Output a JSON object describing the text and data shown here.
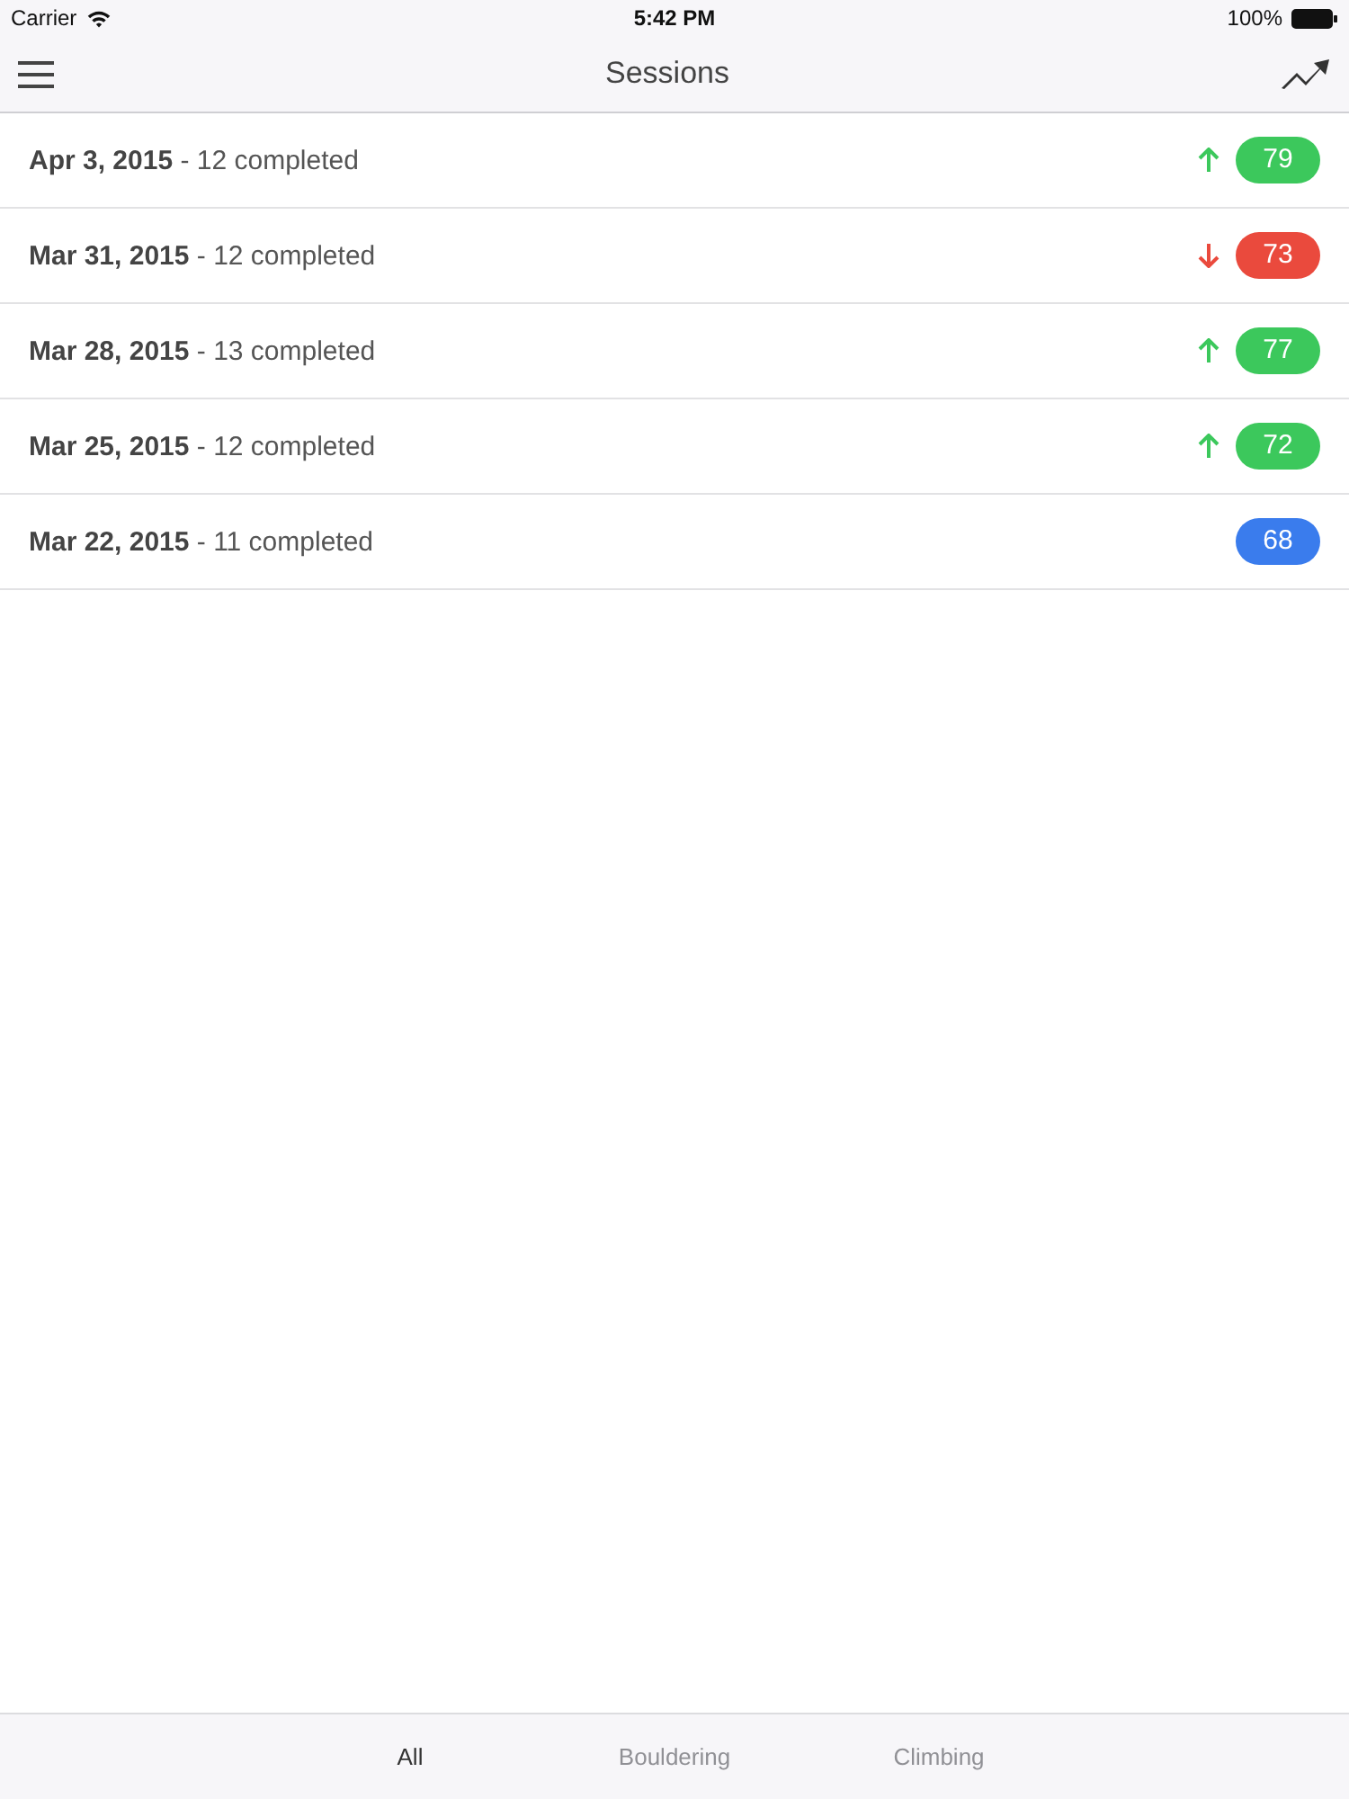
{
  "status_bar": {
    "carrier": "Carrier",
    "time": "5:42 PM",
    "battery": "100%"
  },
  "nav_bar": {
    "title": "Sessions"
  },
  "sessions": [
    {
      "kind": "up",
      "text": "**Apr 3, 2015** - 12 completed",
      "score": "79",
      "color": "#3cc85c"
    },
    {
      "kind": "down",
      "text": "**Mar 31, 2015** - 12 completed",
      "score": "73",
      "color": "#ea4a3d"
    },
    {
      "kind": "up",
      "text": "**Mar 28, 2015** - 13 completed",
      "score": "77",
      "color": "#3cc85c"
    },
    {
      "kind": "up",
      "text": "**Mar 25, 2015** - 12 completed",
      "score": "72",
      "color": "#3cc85c"
    },
    {
      "kind": "plain",
      "text": "**Mar 22, 2015** - 11 completed",
      "score": "68",
      "color": "#3a7ced"
    }
  ],
  "tabs": [
    {
      "label": "All",
      "selected": true
    },
    {
      "label": "Bouldering",
      "selected": false
    },
    {
      "label": "Climbing",
      "selected": false
    }
  ]
}
